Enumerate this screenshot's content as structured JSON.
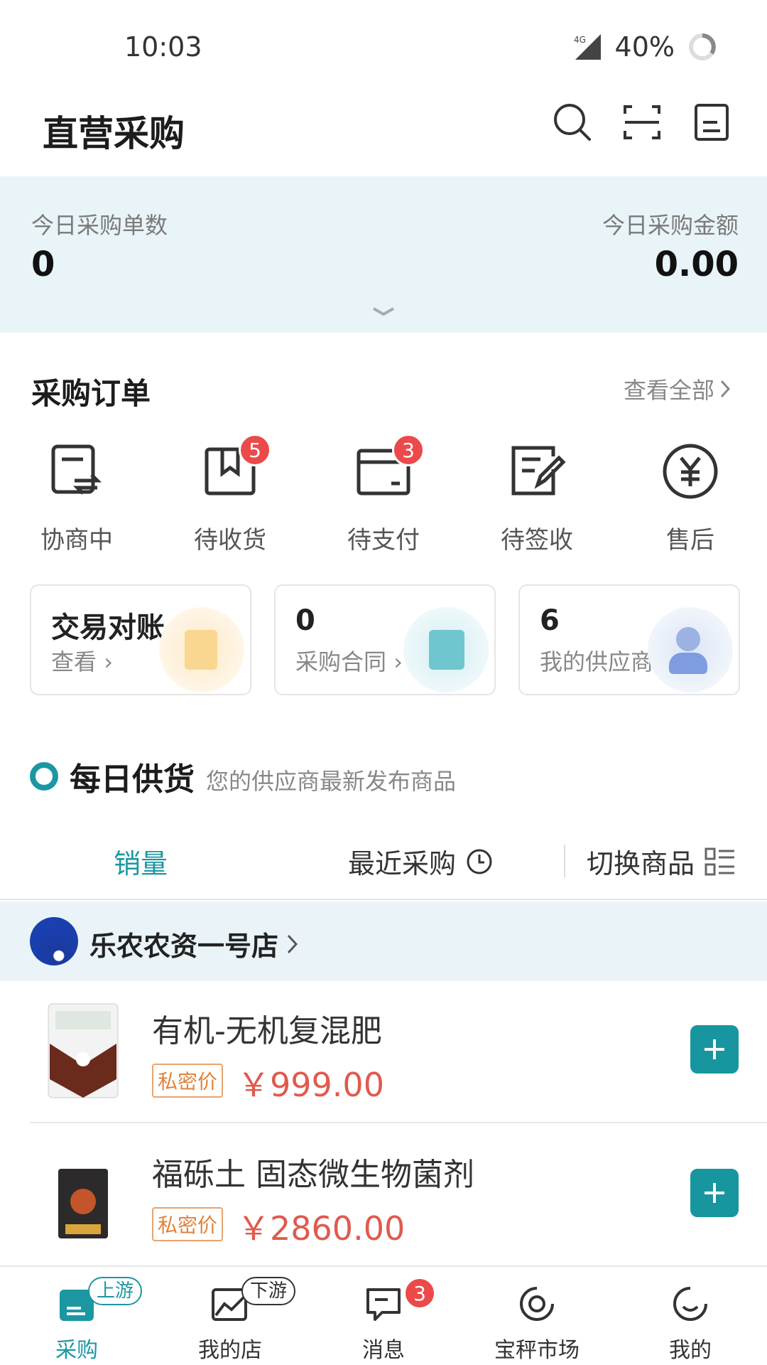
{
  "status_bar": {
    "time": "10:03",
    "network": "4G",
    "battery": "40%"
  },
  "header": {
    "title": "直营采购"
  },
  "summary": {
    "orders_label": "今日采购单数",
    "orders_value": "0",
    "amount_label": "今日采购金额",
    "amount_value": "0.00"
  },
  "orders_section": {
    "title": "采购订单",
    "view_all": "查看全部",
    "items": [
      {
        "label": "协商中",
        "icon": "negotiation-icon",
        "badge": ""
      },
      {
        "label": "待收货",
        "icon": "package-icon",
        "badge": "5"
      },
      {
        "label": "待支付",
        "icon": "wallet-icon",
        "badge": "3"
      },
      {
        "label": "待签收",
        "icon": "sign-icon",
        "badge": ""
      },
      {
        "label": "售后",
        "icon": "yuan-icon",
        "badge": ""
      }
    ]
  },
  "cards": [
    {
      "main": "交易对账",
      "sub": "查看",
      "icon": "reconcile-icon"
    },
    {
      "main": "0",
      "sub": "采购合同",
      "icon": "contract-icon"
    },
    {
      "main": "6",
      "sub": "我的供应商",
      "icon": "supplier-icon"
    }
  ],
  "daily": {
    "title": "每日供货",
    "subtitle": "您的供应商最新发布商品"
  },
  "tabs": {
    "sales": "销量",
    "recent": "最近采购",
    "switch": "切换商品"
  },
  "store": {
    "name": "乐农农资一号店"
  },
  "products": [
    {
      "name": "有机-无机复混肥",
      "tag": "私密价",
      "price": "￥999.00"
    },
    {
      "name": "福砾土 固态微生物菌剂",
      "tag": "私密价",
      "price": "￥2860.00"
    }
  ],
  "bottom_nav": [
    {
      "label": "采购",
      "pill": "上游",
      "badge": ""
    },
    {
      "label": "我的店",
      "pill": "下游",
      "badge": ""
    },
    {
      "label": "消息",
      "pill": "",
      "badge": "3"
    },
    {
      "label": "宝秤市场",
      "pill": "",
      "badge": ""
    },
    {
      "label": "我的",
      "pill": "",
      "badge": ""
    }
  ],
  "colors": {
    "accent": "#1b97a2",
    "badge": "#ec4a4a",
    "price": "#e05a4e",
    "summary_bg": "#e8f4f8"
  }
}
